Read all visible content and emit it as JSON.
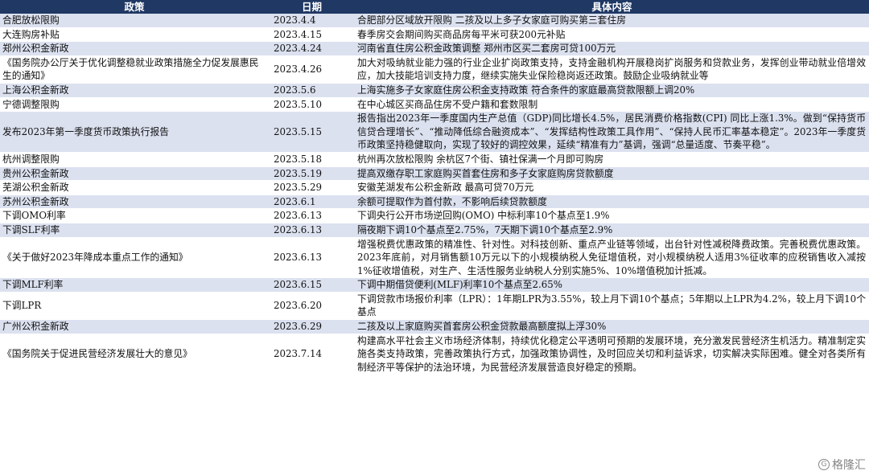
{
  "header": {
    "policy": "政策",
    "date": "日期",
    "content": "具体内容"
  },
  "rows": [
    {
      "policy": "合肥放松限购",
      "date": "2023.4.4",
      "content": "合肥部分区域放开限购 二孩及以上多子女家庭可购买第三套住房"
    },
    {
      "policy": "大连购房补贴",
      "date": "2023.4.15",
      "content": "春季房交会期间购买商品房每平米可获200元补贴"
    },
    {
      "policy": "郑州公积金新政",
      "date": "2023.4.24",
      "content": "河南省直住房公积金政策调整 郑州市区买二套房可贷100万元"
    },
    {
      "policy": "《国务院办公厅关于优化调整稳就业政策措施全力促发展惠民生的通知》",
      "date": "2023.4.26",
      "content": "加大对吸纳就业能力强的行业企业扩岗政策支持，支持金融机构开展稳岗扩岗服务和贷款业务，发挥创业带动就业倍增效应，加大技能培训支持力度，继续实施失业保险稳岗返还政策。鼓励企业吸纳就业等"
    },
    {
      "policy": "上海公积金新政",
      "date": "2023.5.6",
      "content": "上海实施多子女家庭住房公积金支持政策 符合条件的家庭最高贷款限额上调20%"
    },
    {
      "policy": "宁德调整限购",
      "date": "2023.5.10",
      "content": "在中心城区买商品住房不受户籍和套数限制"
    },
    {
      "policy": "发布2023年第一季度货币政策执行报告",
      "date": "2023.5.15",
      "content": "报告指出2023年一季度国内生产总值（GDP)同比增长4.5%，居民消费价格指数(CPI) 同比上涨1.3%。做到“保持货币信贷合理增长”、“推动降低综合融资成本”、“发挥结构性政策工具作用”、“保持人民币汇率基本稳定”。2023年一季度货币政策坚持稳健取向，实现了较好的调控效果，延续“精准有力”基调，强调“总量适度、节奏平稳”。"
    },
    {
      "policy": "杭州调整限购",
      "date": "2023.5.18",
      "content": "杭州再次放松限购 余杭区7个街、镇社保满一个月即可购房"
    },
    {
      "policy": "贵州公积金新政",
      "date": "2023.5.19",
      "content": "提高双缴存职工家庭购买首套住房和多子女家庭购房贷款额度"
    },
    {
      "policy": "芜湖公积金新政",
      "date": "2023.5.29",
      "content": "安徽芜湖发布公积金新政 最高可贷70万元"
    },
    {
      "policy": "苏州公积金新政",
      "date": "2023.6.1",
      "content": "余额可提取作为首付款，不影响后续贷款额度"
    },
    {
      "policy": "下调OMO利率",
      "date": "2023.6.13",
      "content": "下调央行公开市场逆回购(OMO) 中标利率10个基点至1.9%"
    },
    {
      "policy": "下调SLF利率",
      "date": "2023.6.13",
      "content": "隔夜期下调10个基点至2.75%，7天期下调10个基点至2.9%"
    },
    {
      "policy": "《关于做好2023年降成本重点工作的通知》",
      "date": "2023.6.13",
      "content": "增强税费优惠政策的精准性、针对性。对科技创新、重点产业链等领域，出台针对性减税降费政策。完善税费优惠政策。2023年底前，对月销售额10万元以下的小规模纳税人免征增值税，对小规模纳税人适用3%征收率的应税销售收入减按1%征收增值税，对生产、生活性服务业纳税人分别实施5%、10%增值税加计抵减。"
    },
    {
      "policy": "下调MLF利率",
      "date": "2023.6.15",
      "content": "下调中期借贷便利(MLF)利率10个基点至2.65%"
    },
    {
      "policy": "下调LPR",
      "date": "2023.6.20",
      "content": "下调贷款市场报价利率（LPR）：1年期LPR为3.55%，较上月下调10个基点；5年期以上LPR为4.2%，较上月下调10个基点"
    },
    {
      "policy": "广州公积金新政",
      "date": "2023.6.29",
      "content": "二孩及以上家庭购买首套房公积金贷款最高额度拟上浮30%"
    },
    {
      "policy": "《国务院关于促进民营经济发展壮大的意见》",
      "date": "2023.7.14",
      "content": "构建高水平社会主义市场经济体制，持续优化稳定公平透明可预期的发展环境，充分激发民营经济生机活力。精准制定实施各类支持政策，完善政策执行方式，加强政策协调性，及时回应关切和利益诉求，切实解决实际困难。健全对各类所有制经济平等保护的法治环境，为民营经济发展营造良好稳定的预期。"
    }
  ],
  "watermark": "格隆汇"
}
